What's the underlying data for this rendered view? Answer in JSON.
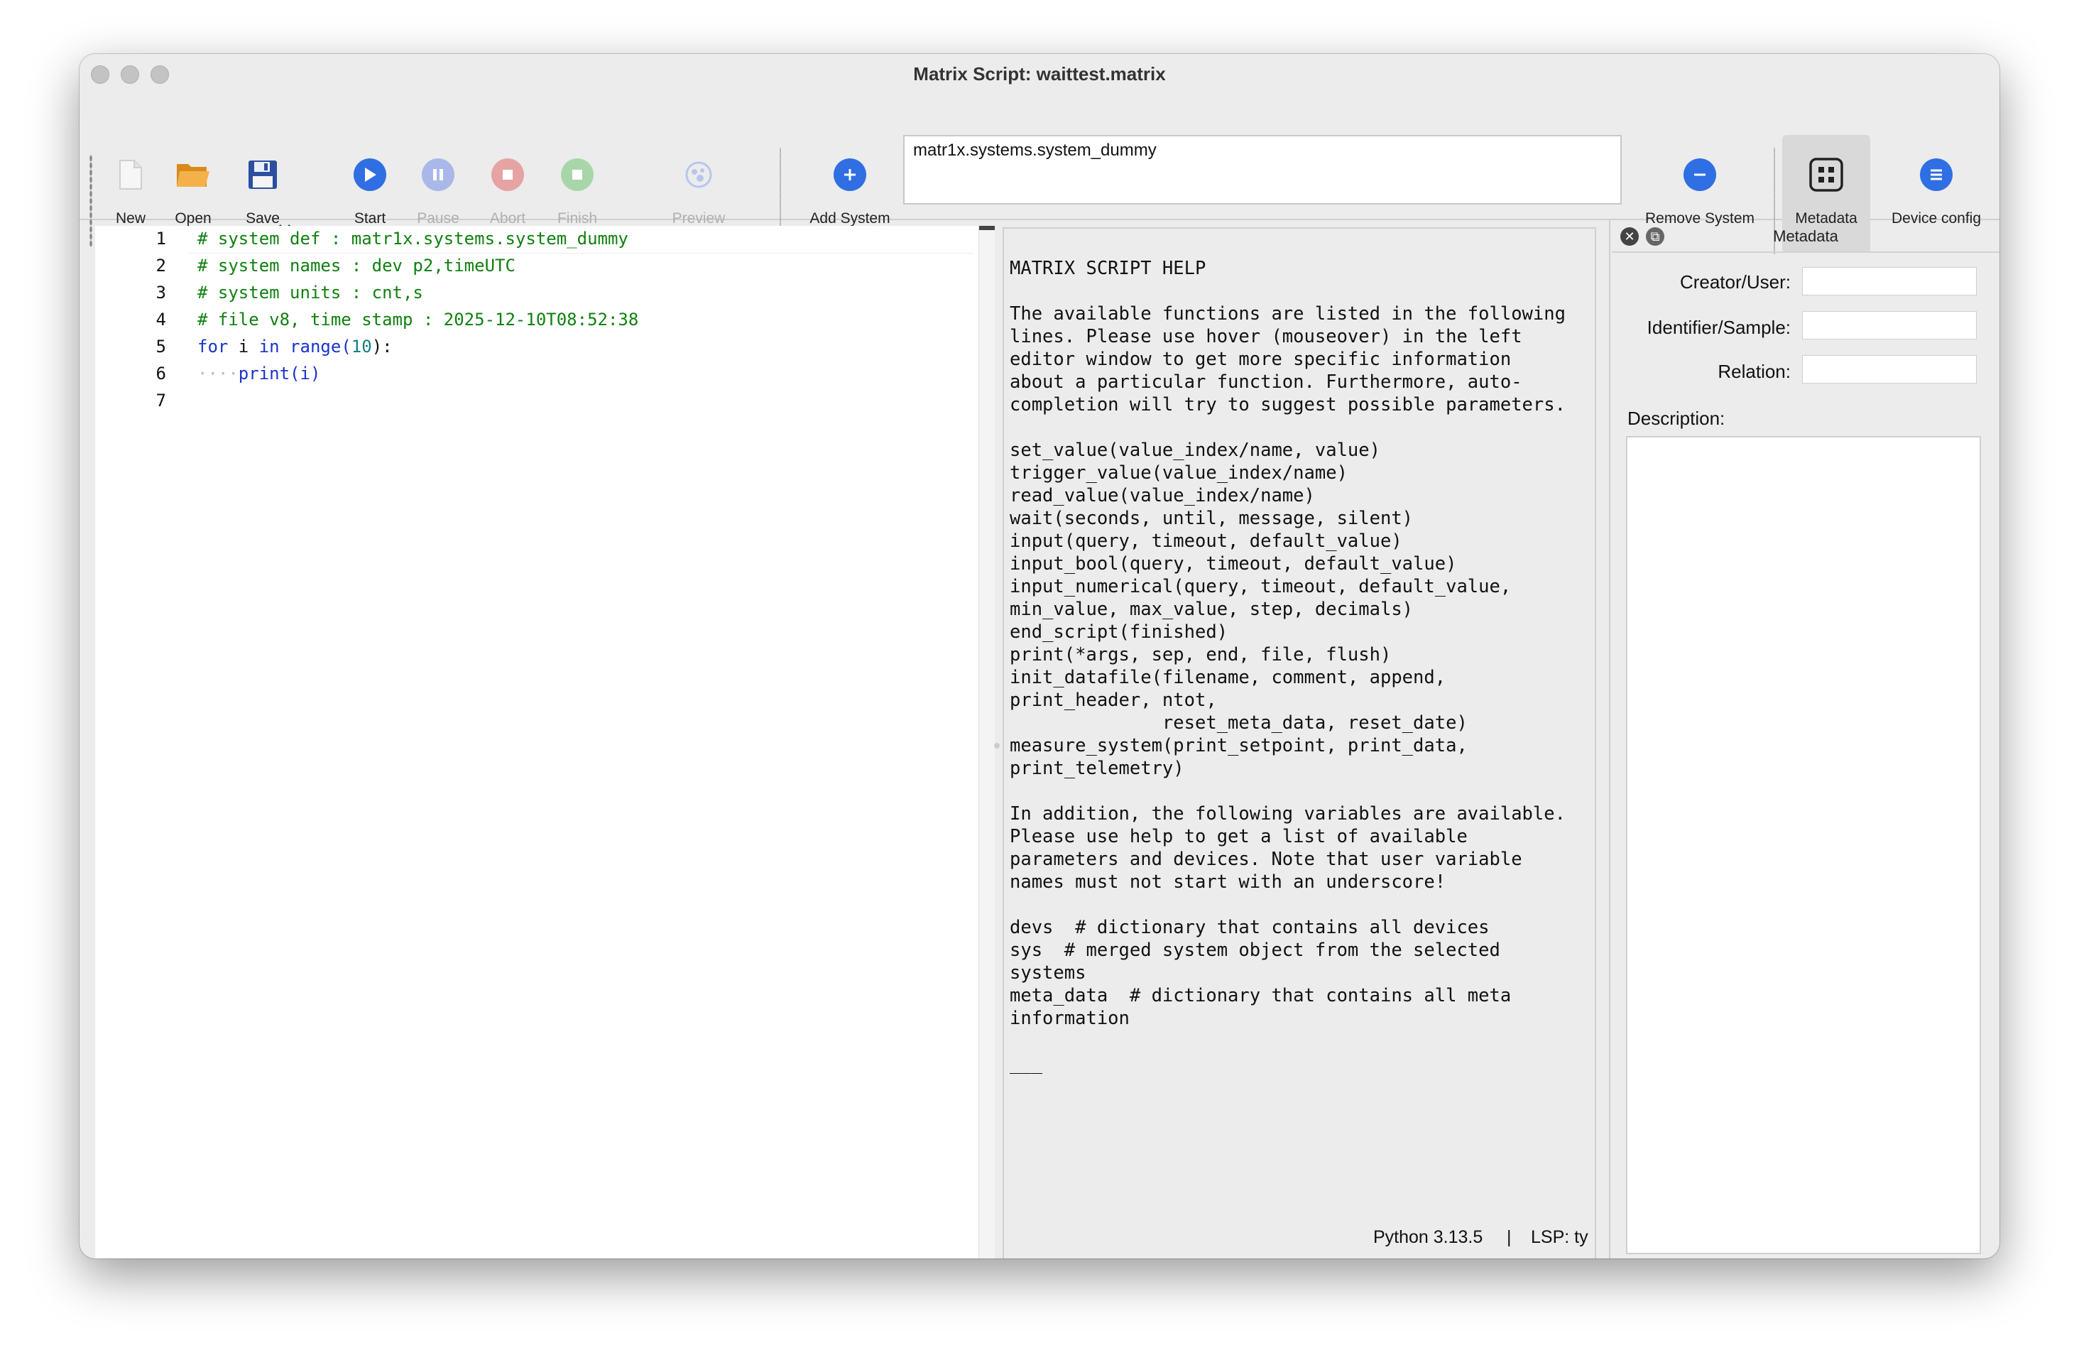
{
  "window": {
    "title": "Matrix Script: waittest.matrix"
  },
  "toolbar": {
    "new": "New",
    "open": "Open",
    "save": "Save",
    "start": "Start",
    "pause": "Pause",
    "abort": "Abort",
    "finish": "Finish",
    "preview": "Preview",
    "add_system": "Add System",
    "system_field": "matr1x.systems.system_dummy",
    "remove_system": "Remove System",
    "metadata": "Metadata",
    "device_config": "Device config"
  },
  "editor": {
    "line_numbers": [
      "1",
      "2",
      "3",
      "4",
      "5",
      "6",
      "7"
    ],
    "lines": {
      "l1": "# system def : matr1x.systems.system_dummy",
      "l2": "# system names : dev p2,timeUTC",
      "l3": "# system units : cnt,s",
      "l4": "# file v8, time stamp : 2025-12-10T08:52:38",
      "l5_kw1": "for",
      "l5_a": " i ",
      "l5_kw2": "in",
      "l5_b": " ",
      "l5_fn": "range",
      "l5_c": "(",
      "l5_num": "10",
      "l5_d": "):",
      "l6_indent": "····",
      "l6_fn": "print",
      "l6_arg": "(i)"
    }
  },
  "help": {
    "text": "MATRIX SCRIPT HELP\n\nThe available functions are listed in the following\nlines. Please use hover (mouseover) in the left\neditor window to get more specific information\nabout a particular function. Furthermore, auto-\ncompletion will try to suggest possible parameters.\n\nset_value(value_index/name, value)\ntrigger_value(value_index/name)\nread_value(value_index/name)\nwait(seconds, until, message, silent)\ninput(query, timeout, default_value)\ninput_bool(query, timeout, default_value)\ninput_numerical(query, timeout, default_value,\nmin_value, max_value, step, decimals)\nend_script(finished)\nprint(*args, sep, end, file, flush)\ninit_datafile(filename, comment, append,\nprint_header, ntot,\n              reset_meta_data, reset_date)\nmeasure_system(print_setpoint, print_data,\nprint_telemetry)\n\nIn addition, the following variables are available.\nPlease use help to get a list of available\nparameters and devices. Note that user variable\nnames must not start with an underscore!\n\ndevs  # dictionary that contains all devices\nsys  # merged system object from the selected\nsystems\nmeta_data  # dictionary that contains all meta\ninformation\n\n___"
  },
  "status": {
    "python": "Python 3.13.5",
    "separator": "|",
    "lsp": "LSP: ty"
  },
  "metadata_panel": {
    "title": "Metadata",
    "creator_label": "Creator/User:",
    "creator_value": "",
    "identifier_label": "Identifier/Sample:",
    "identifier_value": "",
    "relation_label": "Relation:",
    "relation_value": "",
    "description_label": "Description:",
    "description_value": ""
  },
  "colors": {
    "blue": "#2f6fe3",
    "pause": "#a9b8e8",
    "abort": "#e6a3a3",
    "finish": "#a9d6a9",
    "comment": "#108010",
    "keyword": "#1a33c8"
  }
}
